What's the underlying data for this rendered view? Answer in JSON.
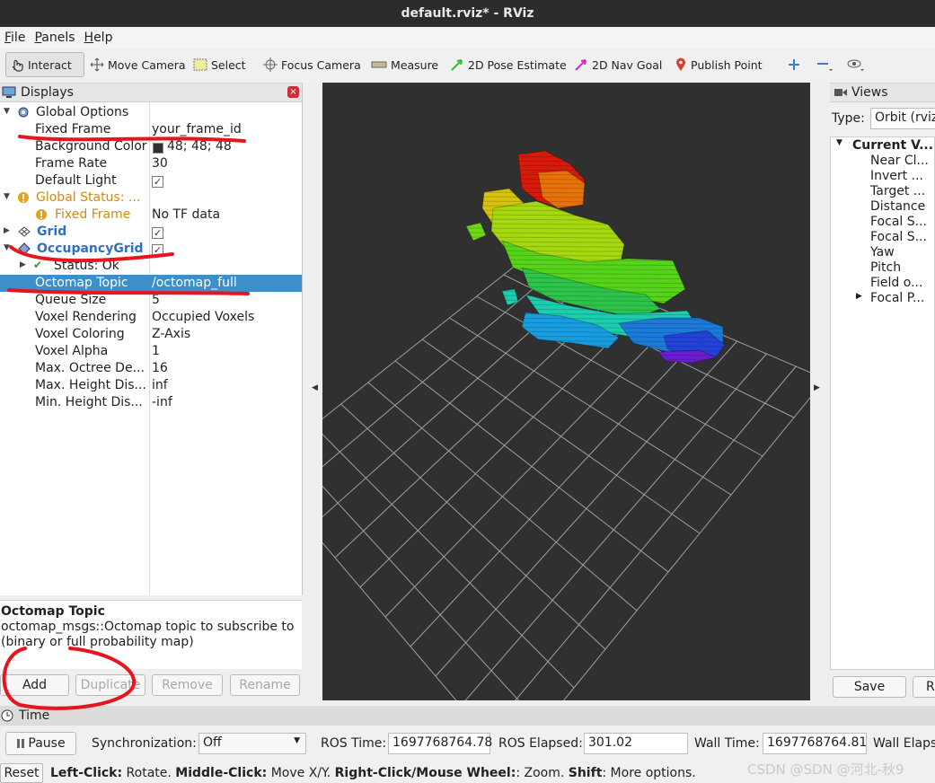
{
  "window": {
    "title": "default.rviz* - RViz"
  },
  "menu": [
    {
      "key": "F",
      "rest": "ile"
    },
    {
      "key": "P",
      "rest": "anels"
    },
    {
      "key": "H",
      "rest": "elp"
    }
  ],
  "toolbar": {
    "interact": "Interact",
    "move_camera": "Move Camera",
    "select": "Select",
    "focus_camera": "Focus Camera",
    "measure": "Measure",
    "pose_estimate": "2D Pose Estimate",
    "nav_goal": "2D Nav Goal",
    "publish_point": "Publish Point"
  },
  "displays": {
    "title": "Displays",
    "global_options": "Global Options",
    "fixed_frame_label": "Fixed Frame",
    "fixed_frame_value": "your_frame_id",
    "background_label": "Background Color",
    "background_value": "48; 48; 48",
    "frame_rate_label": "Frame Rate",
    "frame_rate_value": "30",
    "default_light_label": "Default Light",
    "global_status_label": "Global Status: ...",
    "gs_fixed_frame_label": "Fixed Frame",
    "gs_fixed_frame_value": "No TF data",
    "grid_label": "Grid",
    "occupancy_label": "OccupancyGrid",
    "status_label": "Status: Ok",
    "octomap_topic_label": "Octomap Topic",
    "octomap_topic_value": "/octomap_full",
    "queue_size_label": "Queue Size",
    "queue_size_value": "5",
    "voxel_rendering_label": "Voxel Rendering",
    "voxel_rendering_value": "Occupied Voxels",
    "voxel_coloring_label": "Voxel Coloring",
    "voxel_coloring_value": "Z-Axis",
    "voxel_alpha_label": "Voxel Alpha",
    "voxel_alpha_value": "1",
    "max_octree_label": "Max. Octree De...",
    "max_octree_value": "16",
    "max_height_label": "Max. Height Dis...",
    "max_height_value": "inf",
    "min_height_label": "Min. Height Dis...",
    "min_height_value": "-inf"
  },
  "description": {
    "title": "Octomap Topic",
    "body": "octomap_msgs::Octomap topic to subscribe to (binary or full probability map)"
  },
  "buttons": {
    "add": "Add",
    "duplicate": "Duplicate",
    "remove": "Remove",
    "rename": "Rename"
  },
  "views": {
    "title": "Views",
    "type_label": "Type:",
    "type_value": "Orbit (rviz)",
    "current_view": "Current V...",
    "items": [
      "Near Cl...",
      "Invert ...",
      "Target ...",
      "Distance",
      "Focal S...",
      "Focal S...",
      "Yaw",
      "Pitch",
      "Field o...",
      "Focal P..."
    ],
    "save": "Save",
    "remove": "R"
  },
  "time": {
    "title": "Time",
    "pause": "Pause",
    "sync_label": "Synchronization:",
    "sync_value": "Off",
    "ros_time_label": "ROS Time:",
    "ros_time_value": "1697768764.78",
    "ros_elapsed_label": "ROS Elapsed:",
    "ros_elapsed_value": "301.02",
    "wall_time_label": "Wall Time:",
    "wall_time_value": "1697768764.81",
    "wall_elapsed_label": "Wall Elaps"
  },
  "status": {
    "reset": "Reset",
    "hint": [
      {
        "b": "Left-Click:",
        "t": " Rotate. "
      },
      {
        "b": "Middle-Click:",
        "t": " Move X/Y. "
      },
      {
        "b": "Right-Click/Mouse Wheel:",
        "t": ": Zoom. "
      },
      {
        "b": "Shift",
        "t": ": More options."
      }
    ],
    "watermark": "CSDN @SDN @河北-秋9"
  },
  "colors": {
    "viewport_bg": "#303030",
    "selection": "#3d8fc9",
    "annotation": "#e8141e"
  }
}
